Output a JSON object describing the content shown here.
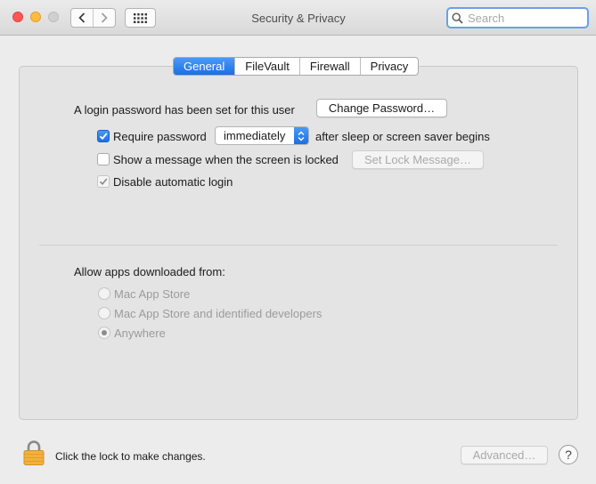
{
  "window": {
    "title": "Security & Privacy"
  },
  "toolbar": {
    "search_placeholder": "Search"
  },
  "tabs": [
    {
      "label": "General",
      "active": true
    },
    {
      "label": "FileVault",
      "active": false
    },
    {
      "label": "Firewall",
      "active": false
    },
    {
      "label": "Privacy",
      "active": false
    }
  ],
  "general": {
    "login_password_text": "A login password has been set for this user",
    "change_password_label": "Change Password…",
    "require_password": {
      "label": "Require password",
      "checked": true
    },
    "require_password_delay": "immediately",
    "after_sleep_text": "after sleep or screen saver begins",
    "show_message": {
      "label": "Show a message when the screen is locked",
      "checked": false
    },
    "set_lock_message_label": "Set Lock Message…",
    "disable_auto_login": {
      "label": "Disable automatic login",
      "checked": true,
      "enabled": false
    }
  },
  "downloads": {
    "heading": "Allow apps downloaded from:",
    "options": [
      {
        "label": "Mac App Store",
        "selected": false
      },
      {
        "label": "Mac App Store and identified developers",
        "selected": false
      },
      {
        "label": "Anywhere",
        "selected": true
      }
    ]
  },
  "footer": {
    "lock_text": "Click the lock to make changes.",
    "advanced_label": "Advanced…",
    "help_label": "?"
  },
  "icons": {
    "search": "search-icon",
    "back": "chevron-left-icon",
    "forward": "chevron-right-icon",
    "show_all": "grid-icon",
    "lock": "lock-icon"
  },
  "colors": {
    "accent": "#1b6fe4",
    "close": "#fc5753",
    "minimize": "#fdbc40",
    "lock": "#f3b13b"
  }
}
